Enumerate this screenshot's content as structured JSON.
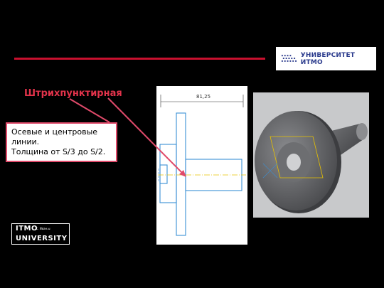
{
  "header": {
    "brand_label": "УНИВЕРСИТЕТ ИТМО"
  },
  "slide": {
    "title": "Штрихпунктирная",
    "callout_lines": [
      "Осевые и центровые",
      "линии.",
      "Толщина  от S/3 до S/2."
    ]
  },
  "drawing": {
    "dimension_label": "81,25"
  },
  "footer_logo": {
    "line1": "ITMO",
    "line1_small": "с. Иван.ы",
    "line2": "UNIVERSITY"
  },
  "colors": {
    "accent": "#c8102e",
    "title": "#e2334b",
    "brand_blue": "#2a3a8c",
    "drawing_lines": "#3a8fd4"
  },
  "icons": [
    "itmo-logo-icon",
    "itmo-university-logo"
  ]
}
